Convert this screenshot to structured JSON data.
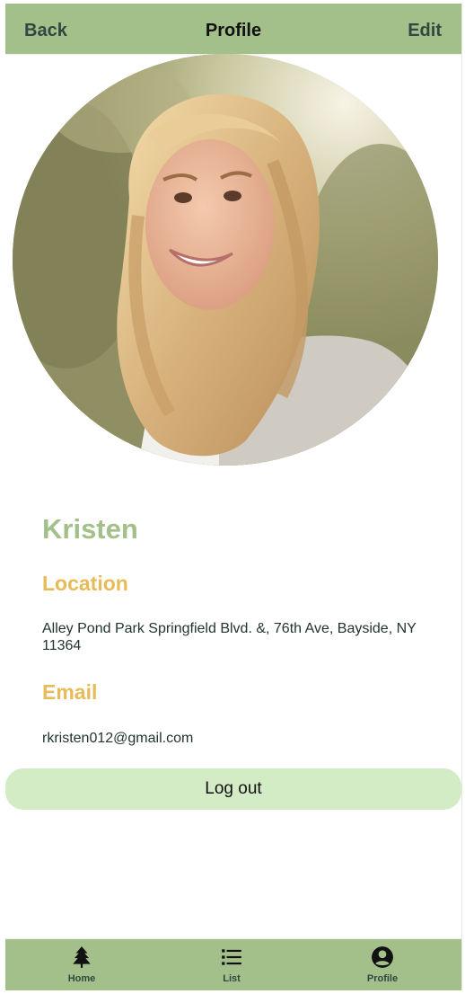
{
  "header": {
    "back_label": "Back",
    "title": "Profile",
    "edit_label": "Edit"
  },
  "profile": {
    "photo_description": "profile-photo",
    "name": "Kristen",
    "location_heading": "Location",
    "location_value": "Alley Pond Park Springfield Blvd. &, 76th Ave, Bayside, NY 11364",
    "email_heading": "Email",
    "email_value": "rkristen012@gmail.com"
  },
  "actions": {
    "logout_label": "Log out"
  },
  "tabbar": {
    "tabs": [
      {
        "label": "Home",
        "icon": "tree-icon"
      },
      {
        "label": "List",
        "icon": "list-icon"
      },
      {
        "label": "Profile",
        "icon": "account-circle-icon"
      }
    ],
    "active": "Profile"
  },
  "colors": {
    "header_bg": "#a4c08a",
    "name_color": "#a4c08a",
    "heading_color": "#e7bb58",
    "button_bg": "#d3ecc5",
    "text_dark": "#23342f"
  }
}
